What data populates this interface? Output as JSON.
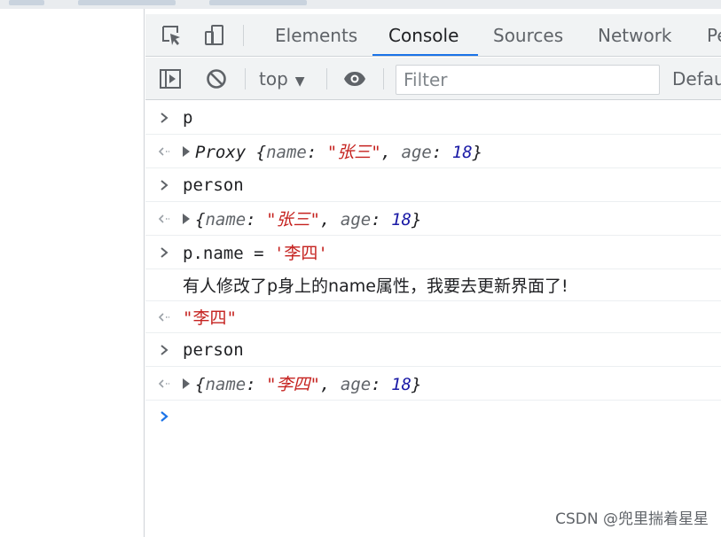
{
  "tabs": [
    {
      "label": "Elements",
      "active": false
    },
    {
      "label": "Console",
      "active": true
    },
    {
      "label": "Sources",
      "active": false
    },
    {
      "label": "Network",
      "active": false
    },
    {
      "label": "Pe",
      "active": false
    }
  ],
  "toolbar": {
    "context": "top",
    "filter_placeholder": "Filter",
    "levels": "Defau"
  },
  "console": {
    "rows": [
      {
        "kind": "input",
        "text": "p"
      },
      {
        "kind": "result",
        "prefix": "Proxy ",
        "open": "{",
        "k1": "name",
        "v1": "\"张三\"",
        "k2": "age",
        "v2": "18",
        "close": "}"
      },
      {
        "kind": "input",
        "text": "person"
      },
      {
        "kind": "result",
        "prefix": "",
        "open": "{",
        "k1": "name",
        "v1": "\"张三\"",
        "k2": "age",
        "v2": "18",
        "close": "}"
      },
      {
        "kind": "input_assign",
        "code": "p.name = ",
        "value": "'李四'"
      },
      {
        "kind": "log",
        "text": "有人修改了p身上的name属性，我要去更新界面了!"
      },
      {
        "kind": "string_result",
        "text": "\"李四\""
      },
      {
        "kind": "input",
        "text": "person"
      },
      {
        "kind": "result",
        "prefix": "",
        "open": "{",
        "k1": "name",
        "v1": "\"李四\"",
        "k2": "age",
        "v2": "18",
        "close": "}"
      }
    ]
  },
  "watermark": "CSDN @兜里揣着星星",
  "colors": {
    "accent": "#1a73e8",
    "string": "#c5221f",
    "number": "#1a1aa6",
    "toolbar_bg": "#f1f3f4"
  },
  "icons": {
    "inspect": "inspect-element-icon",
    "device": "device-toolbar-icon",
    "sidebar": "show-console-sidebar-icon",
    "clear": "clear-console-icon",
    "eye": "live-expression-eye-icon",
    "input_prompt": "chevron-right-icon",
    "result_marker": "return-arrow-icon"
  }
}
